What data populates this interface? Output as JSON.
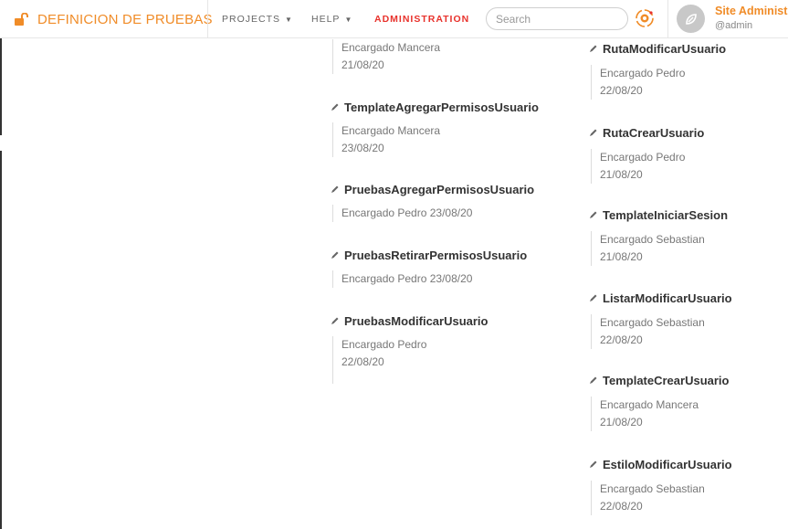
{
  "navbar": {
    "brand": "DEFINICION DE PRUEBAS",
    "links": [
      {
        "label": "PROJECTS",
        "caret": "▼"
      },
      {
        "label": "HELP",
        "caret": "▼"
      },
      {
        "label": "ADMINISTRATION"
      }
    ],
    "search_placeholder": "Search",
    "user_name": "Site Administr",
    "user_handle": "@admin"
  },
  "colors": {
    "accent": "#f08c28",
    "admin": "#e8322c",
    "text": "#333333",
    "muted": "#777777"
  },
  "icons": {
    "brand": "unlock-icon",
    "task": "pencil-icon",
    "app": "logo-icon",
    "avatar": "avatar-icon"
  },
  "column1": [
    {
      "title": "",
      "assignee": "Encargado Mancera",
      "date": "21/08/20"
    },
    {
      "title": "TemplateAgregarPermisosUsuario",
      "assignee": "Encargado Mancera",
      "date": "23/08/20"
    },
    {
      "title": "PruebasAgregarPermisosUsuario",
      "assignee": "Encargado Pedro 23/08/20"
    },
    {
      "title": "PruebasRetirarPermisosUsuario",
      "assignee": "Encargado Pedro 23/08/20"
    },
    {
      "title": "PruebasModificarUsuario",
      "assignee": "Encargado Pedro",
      "date": "22/08/20"
    }
  ],
  "column2": [
    {
      "title": "RutaModificarUsuario",
      "assignee": "Encargado Pedro",
      "date": "22/08/20"
    },
    {
      "title": "RutaCrearUsuario",
      "assignee": "Encargado Pedro",
      "date": "21/08/20"
    },
    {
      "title": "TemplateIniciarSesion",
      "assignee": "Encargado Sebastian",
      "date": "21/08/20"
    },
    {
      "title": "ListarModificarUsuario",
      "assignee": "Encargado Sebastian",
      "date": "22/08/20"
    },
    {
      "title": "TemplateCrearUsuario",
      "assignee": "Encargado Mancera",
      "date": "21/08/20"
    },
    {
      "title": "EstiloModificarUsuario",
      "assignee": "Encargado Sebastian",
      "date": "22/08/20"
    }
  ]
}
